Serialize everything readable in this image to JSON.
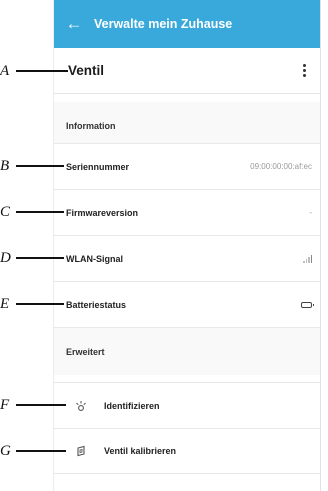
{
  "appbar": {
    "back_glyph": "←",
    "title": "Verwalte mein Zuhause"
  },
  "device": {
    "name": "Ventil",
    "menu_icon": "kebab-menu-icon"
  },
  "sections": {
    "information": "Information",
    "advanced": "Erweitert"
  },
  "info_rows": {
    "serial": {
      "label": "Seriennummer",
      "value": "09:00:00:00:af:ec"
    },
    "firmware": {
      "label": "Firmwareversion",
      "value": "-"
    },
    "wifi": {
      "label": "WLAN-Signal",
      "icon": "signal-icon"
    },
    "battery": {
      "label": "Batteriestatus",
      "icon": "battery-icon"
    }
  },
  "actions": {
    "identify": {
      "label": "Identifizieren",
      "icon": "light-burst-icon"
    },
    "calibrate": {
      "label": "Ventil kalibrieren",
      "icon": "calibrate-icon"
    }
  },
  "callouts": [
    "A",
    "B",
    "C",
    "D",
    "E",
    "F",
    "G"
  ],
  "colors": {
    "appbar": "#39a9dc",
    "section_bg": "#f9f9f9"
  }
}
